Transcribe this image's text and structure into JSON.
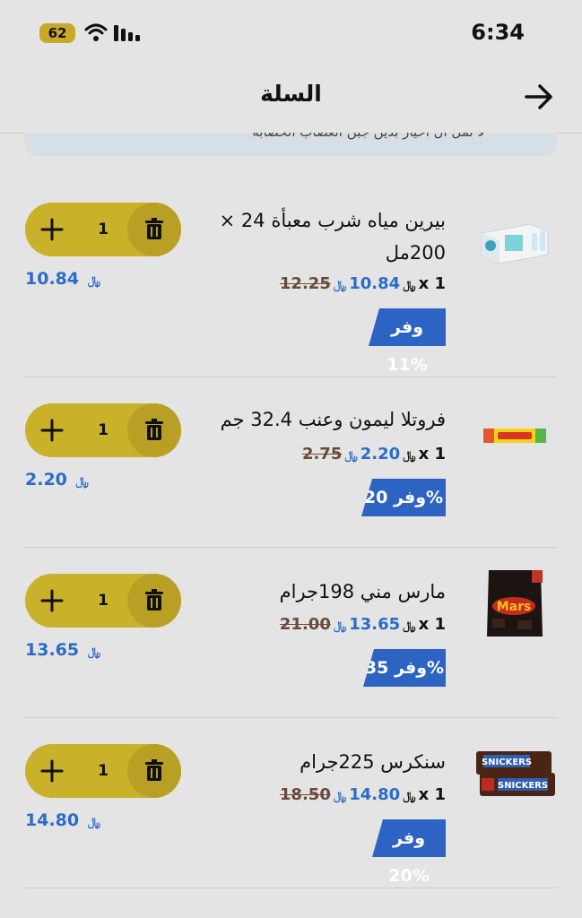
{
  "status_bar": {
    "battery": "62",
    "time": "6:34"
  },
  "header": {
    "title": "السلة"
  },
  "banner": {
    "text": "لا تمل ال اخيار بدين جبن العصاب الحصابة"
  },
  "currency_symbol": "﷼",
  "items": [
    {
      "name": "بيرين مياه شرب معبأة 24 × 200مل",
      "qty_prefix": "x 1",
      "price": "10.84",
      "old_price": "12.25",
      "badge": "وفر 11%",
      "quantity": "1",
      "total": "10.84",
      "icon": "water-pack"
    },
    {
      "name": "فروتلا ليمون وعنب 32.4 جم",
      "qty_prefix": "x 1",
      "price": "2.20",
      "old_price": "2.75",
      "badge": "وفر 20%",
      "quantity": "1",
      "total": "2.20",
      "icon": "candy-stick"
    },
    {
      "name": "مارس مني 198جرام",
      "qty_prefix": "x 1",
      "price": "13.65",
      "old_price": "21.00",
      "badge": "وفر 35%",
      "quantity": "1",
      "total": "13.65",
      "icon": "mars-bag"
    },
    {
      "name": "سنكرس 225جرام",
      "qty_prefix": "x 1",
      "price": "14.80",
      "old_price": "18.50",
      "badge": "وفر 20%",
      "quantity": "1",
      "total": "14.80",
      "icon": "snickers-pack"
    }
  ]
}
